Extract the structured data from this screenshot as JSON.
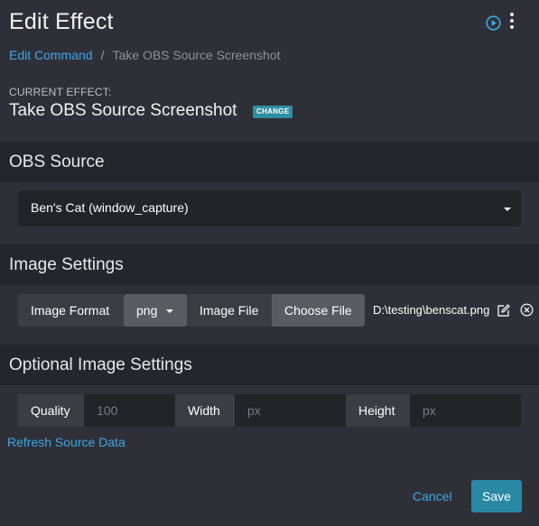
{
  "header": {
    "title": "Edit Effect",
    "breadcrumb": {
      "link": "Edit Command",
      "separator": "/",
      "current": "Take OBS Source Screenshot"
    },
    "current_effect_label": "CURRENT EFFECT:",
    "current_effect_name": "Take OBS Source Screenshot",
    "change_label": "CHANGE",
    "icons": [
      "play-circle-icon",
      "more-vertical-icon"
    ]
  },
  "obs_source": {
    "title": "OBS Source",
    "selected": "Ben's Cat (window_capture)"
  },
  "image_settings": {
    "title": "Image Settings",
    "format_label": "Image Format",
    "format_value": "png",
    "file_label": "Image File",
    "choose_file_label": "Choose File",
    "file_path": "D:\\testing\\benscat.png",
    "icons": [
      "edit-icon",
      "clear-icon"
    ]
  },
  "optional_settings": {
    "title": "Optional Image Settings",
    "quality_label": "Quality",
    "quality_placeholder": "100",
    "width_label": "Width",
    "width_placeholder": "px",
    "height_label": "Height",
    "height_placeholder": "px"
  },
  "refresh_label": "Refresh Source Data",
  "footer": {
    "cancel_label": "Cancel",
    "save_label": "Save"
  },
  "colors": {
    "accent": "#3ea6e8",
    "primary_button": "#2988a3",
    "badge": "#2f8fa3",
    "background": "#2f3037",
    "section_header": "#25262b"
  }
}
